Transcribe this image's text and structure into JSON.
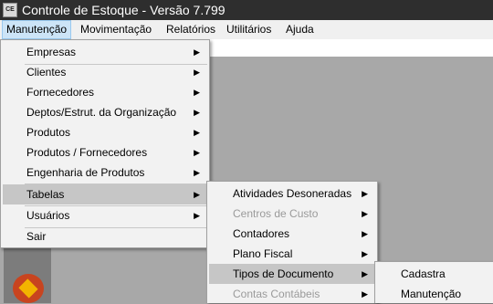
{
  "window": {
    "title": "Controle de Estoque - Versão 7.799",
    "icon_label": "CE"
  },
  "menubar": [
    {
      "label": "Manutenção",
      "active": true
    },
    {
      "label": "Movimentação",
      "active": false
    },
    {
      "label": "Relatórios",
      "active": false
    },
    {
      "label": "Utilitários",
      "active": false
    },
    {
      "label": "Ajuda",
      "active": false
    }
  ],
  "menu_manutencao": {
    "items": [
      {
        "label": "Empresas",
        "submenu": true
      },
      {
        "label": "Clientes",
        "submenu": true
      },
      {
        "label": "Fornecedores",
        "submenu": true
      },
      {
        "label": "Deptos/Estrut. da Organização",
        "submenu": true
      },
      {
        "label": "Produtos",
        "submenu": true
      },
      {
        "label": "Produtos / Fornecedores",
        "submenu": true
      },
      {
        "label": "Engenharia de Produtos",
        "submenu": true
      },
      {
        "label": "Tabelas",
        "submenu": true,
        "highlighted": true
      },
      {
        "label": "Usuários",
        "submenu": true
      },
      {
        "label": "Sair",
        "submenu": false
      }
    ]
  },
  "menu_tabelas": {
    "items": [
      {
        "label": "Atividades Desoneradas",
        "submenu": true,
        "disabled": false
      },
      {
        "label": "Centros de Custo",
        "submenu": true,
        "disabled": true
      },
      {
        "label": "Contadores",
        "submenu": true,
        "disabled": false
      },
      {
        "label": "Plano Fiscal",
        "submenu": true,
        "disabled": false
      },
      {
        "label": "Tipos de Documento",
        "submenu": true,
        "disabled": false,
        "highlighted": true
      },
      {
        "label": "Contas Contábeis",
        "submenu": true,
        "disabled": true
      }
    ]
  },
  "menu_tipos_documento": {
    "items": [
      {
        "label": "Cadastra"
      },
      {
        "label": "Manutenção"
      }
    ]
  },
  "colors": {
    "titlebar": "#2e2e2e",
    "menubar": "#f0f0f0",
    "menu_bg": "#f2f2f2",
    "highlight": "#c6c6c6",
    "desktop": "#a8a8a8"
  },
  "icons": {
    "app": "app-icon",
    "submenu_arrow": "▶",
    "logo": "red-orange-logo-icon"
  }
}
